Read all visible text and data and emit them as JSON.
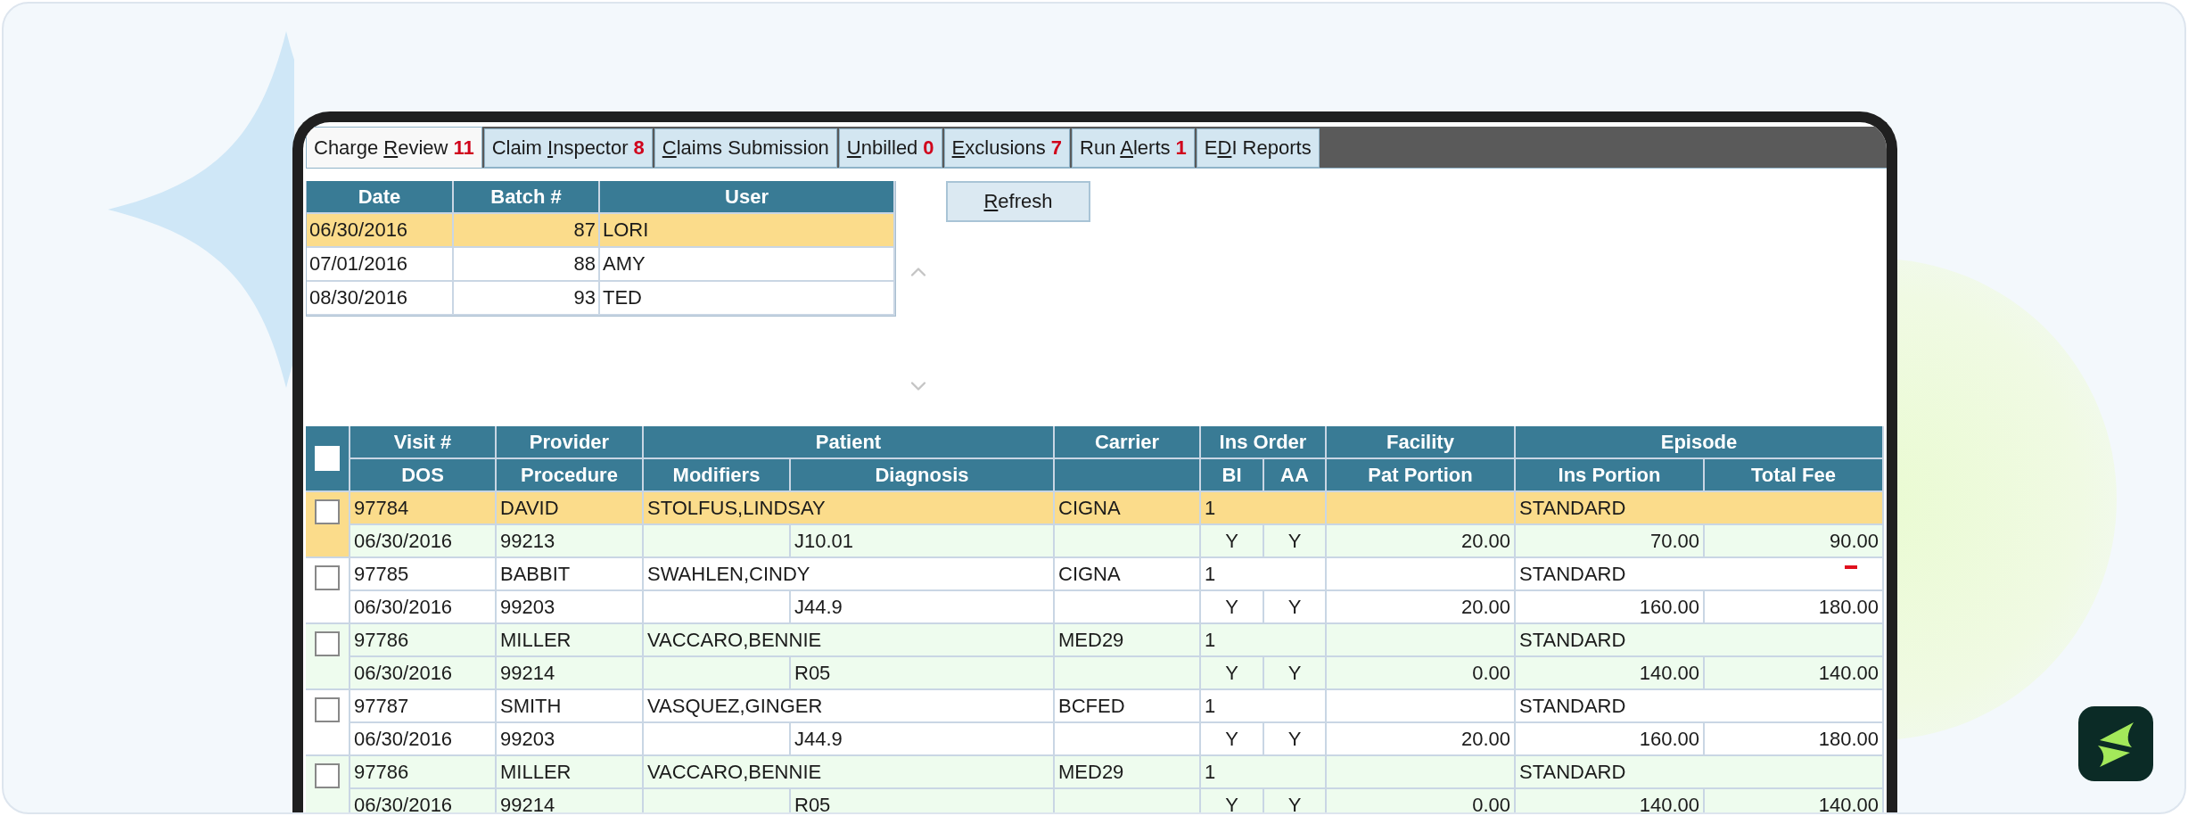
{
  "tabs": [
    {
      "label": {
        "pre": "Charge ",
        "key": "R",
        "post": "eview"
      },
      "count": "11",
      "selected": true
    },
    {
      "label": {
        "pre": "Claim ",
        "key": "I",
        "post": "nspector"
      },
      "count": "8",
      "selected": false
    },
    {
      "label": {
        "key": "C",
        "post": "laims Submission"
      },
      "selected": false
    },
    {
      "label": {
        "key": "U",
        "post": "nbilled"
      },
      "count": "0",
      "selected": false
    },
    {
      "label": {
        "key": "E",
        "post": "xclusions"
      },
      "count": "7",
      "selected": false
    },
    {
      "label": {
        "pre": "Run ",
        "key": "A",
        "post": "lerts"
      },
      "count": "1",
      "selected": false
    },
    {
      "label": {
        "pre": "E",
        "key": "D",
        "post": "I Reports"
      },
      "selected": false
    }
  ],
  "batches": {
    "columns": [
      "Date",
      "Batch #",
      "User"
    ],
    "rows": [
      {
        "date": "06/30/2016",
        "batch": "87",
        "user": "LORI",
        "selected": true
      },
      {
        "date": "07/01/2016",
        "batch": "88",
        "user": "AMY",
        "selected": false
      },
      {
        "date": "08/30/2016",
        "batch": "93",
        "user": "TED",
        "selected": false
      }
    ]
  },
  "refresh_button": {
    "label": {
      "key": "R",
      "post": "efresh"
    }
  },
  "claims": {
    "header_checked": false,
    "header_top": {
      "visit": "Visit #",
      "provider": "Provider",
      "patient": "Patient",
      "carrier": "Carrier",
      "ins_order": "Ins Order",
      "facility": "Facility",
      "episode": "Episode"
    },
    "header_bottom": {
      "dos": "DOS",
      "procedure": "Procedure",
      "modifiers": "Modifiers",
      "diagnosis": "Diagnosis",
      "bi": "BI",
      "aa": "AA",
      "pat_portion": "Pat Portion",
      "ins_portion": "Ins Portion",
      "total_fee": "Total Fee"
    },
    "rows": [
      {
        "visit": "97784",
        "provider": "DAVID",
        "patient": "STOLFUS,LINDSAY",
        "carrier": "CIGNA",
        "ins_order": "1",
        "episode": "STANDARD",
        "dos": "06/30/2016",
        "procedure": "99213",
        "diagnosis": "J10.01",
        "bi": "Y",
        "aa": "Y",
        "pat_portion": "20.00",
        "ins_portion": "70.00",
        "total_fee": "90.00",
        "selected": true,
        "checked": false
      },
      {
        "visit": "97785",
        "provider": "BABBIT",
        "patient": "SWAHLEN,CINDY",
        "carrier": "CIGNA",
        "ins_order": "1",
        "episode": "STANDARD",
        "dos": "06/30/2016",
        "procedure": "99203",
        "diagnosis": "J44.9",
        "bi": "Y",
        "aa": "Y",
        "pat_portion": "20.00",
        "ins_portion": "160.00",
        "total_fee": "180.00",
        "selected": false,
        "checked": false
      },
      {
        "visit": "97786",
        "provider": "MILLER",
        "patient": "VACCARO,BENNIE",
        "carrier": "MED29",
        "ins_order": "1",
        "episode": "STANDARD",
        "dos": "06/30/2016",
        "procedure": "99214",
        "diagnosis": "R05",
        "bi": "Y",
        "aa": "Y",
        "pat_portion": "0.00",
        "ins_portion": "140.00",
        "total_fee": "140.00",
        "selected": false,
        "checked": false
      },
      {
        "visit": "97787",
        "provider": "SMITH",
        "patient": "VASQUEZ,GINGER",
        "carrier": "BCFED",
        "ins_order": "1",
        "episode": "STANDARD",
        "dos": "06/30/2016",
        "procedure": "99203",
        "diagnosis": "J44.9",
        "bi": "Y",
        "aa": "Y",
        "pat_portion": "20.00",
        "ins_portion": "160.00",
        "total_fee": "180.00",
        "selected": false,
        "checked": false
      },
      {
        "visit": "97786",
        "provider": "MILLER",
        "patient": "VACCARO,BENNIE",
        "carrier": "MED29",
        "ins_order": "1",
        "episode": "STANDARD",
        "dos": "06/30/2016",
        "procedure": "99214",
        "diagnosis": "R05",
        "bi": "Y",
        "aa": "Y",
        "pat_portion": "0.00",
        "ins_portion": "140.00",
        "total_fee": "140.00",
        "selected": false,
        "checked": false
      }
    ]
  }
}
